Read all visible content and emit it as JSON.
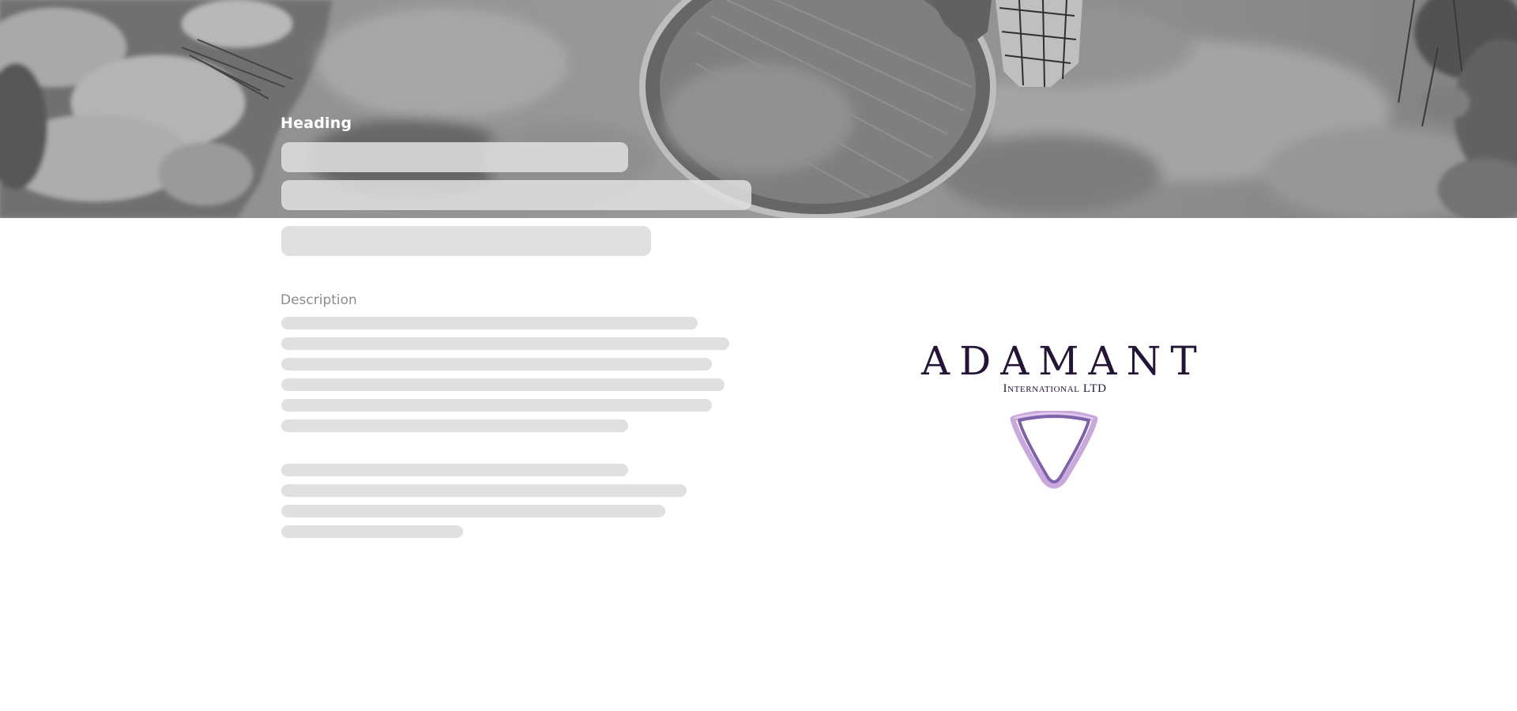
{
  "hero": {
    "heading": "Heading"
  },
  "content": {
    "description_label": "Description"
  },
  "logo": {
    "wordmark": "ADAMANT",
    "subtitle": "International LTD",
    "mark_icon": "v-shaped-diamond-icon",
    "colors": {
      "wordmark": "#241536",
      "mark_primary": "#7d62aa",
      "mark_secondary": "#c9a9dc"
    }
  },
  "colors": {
    "skeleton": "#e0e0e0",
    "label": "#8c8c8c",
    "heading": "#ffffff"
  }
}
